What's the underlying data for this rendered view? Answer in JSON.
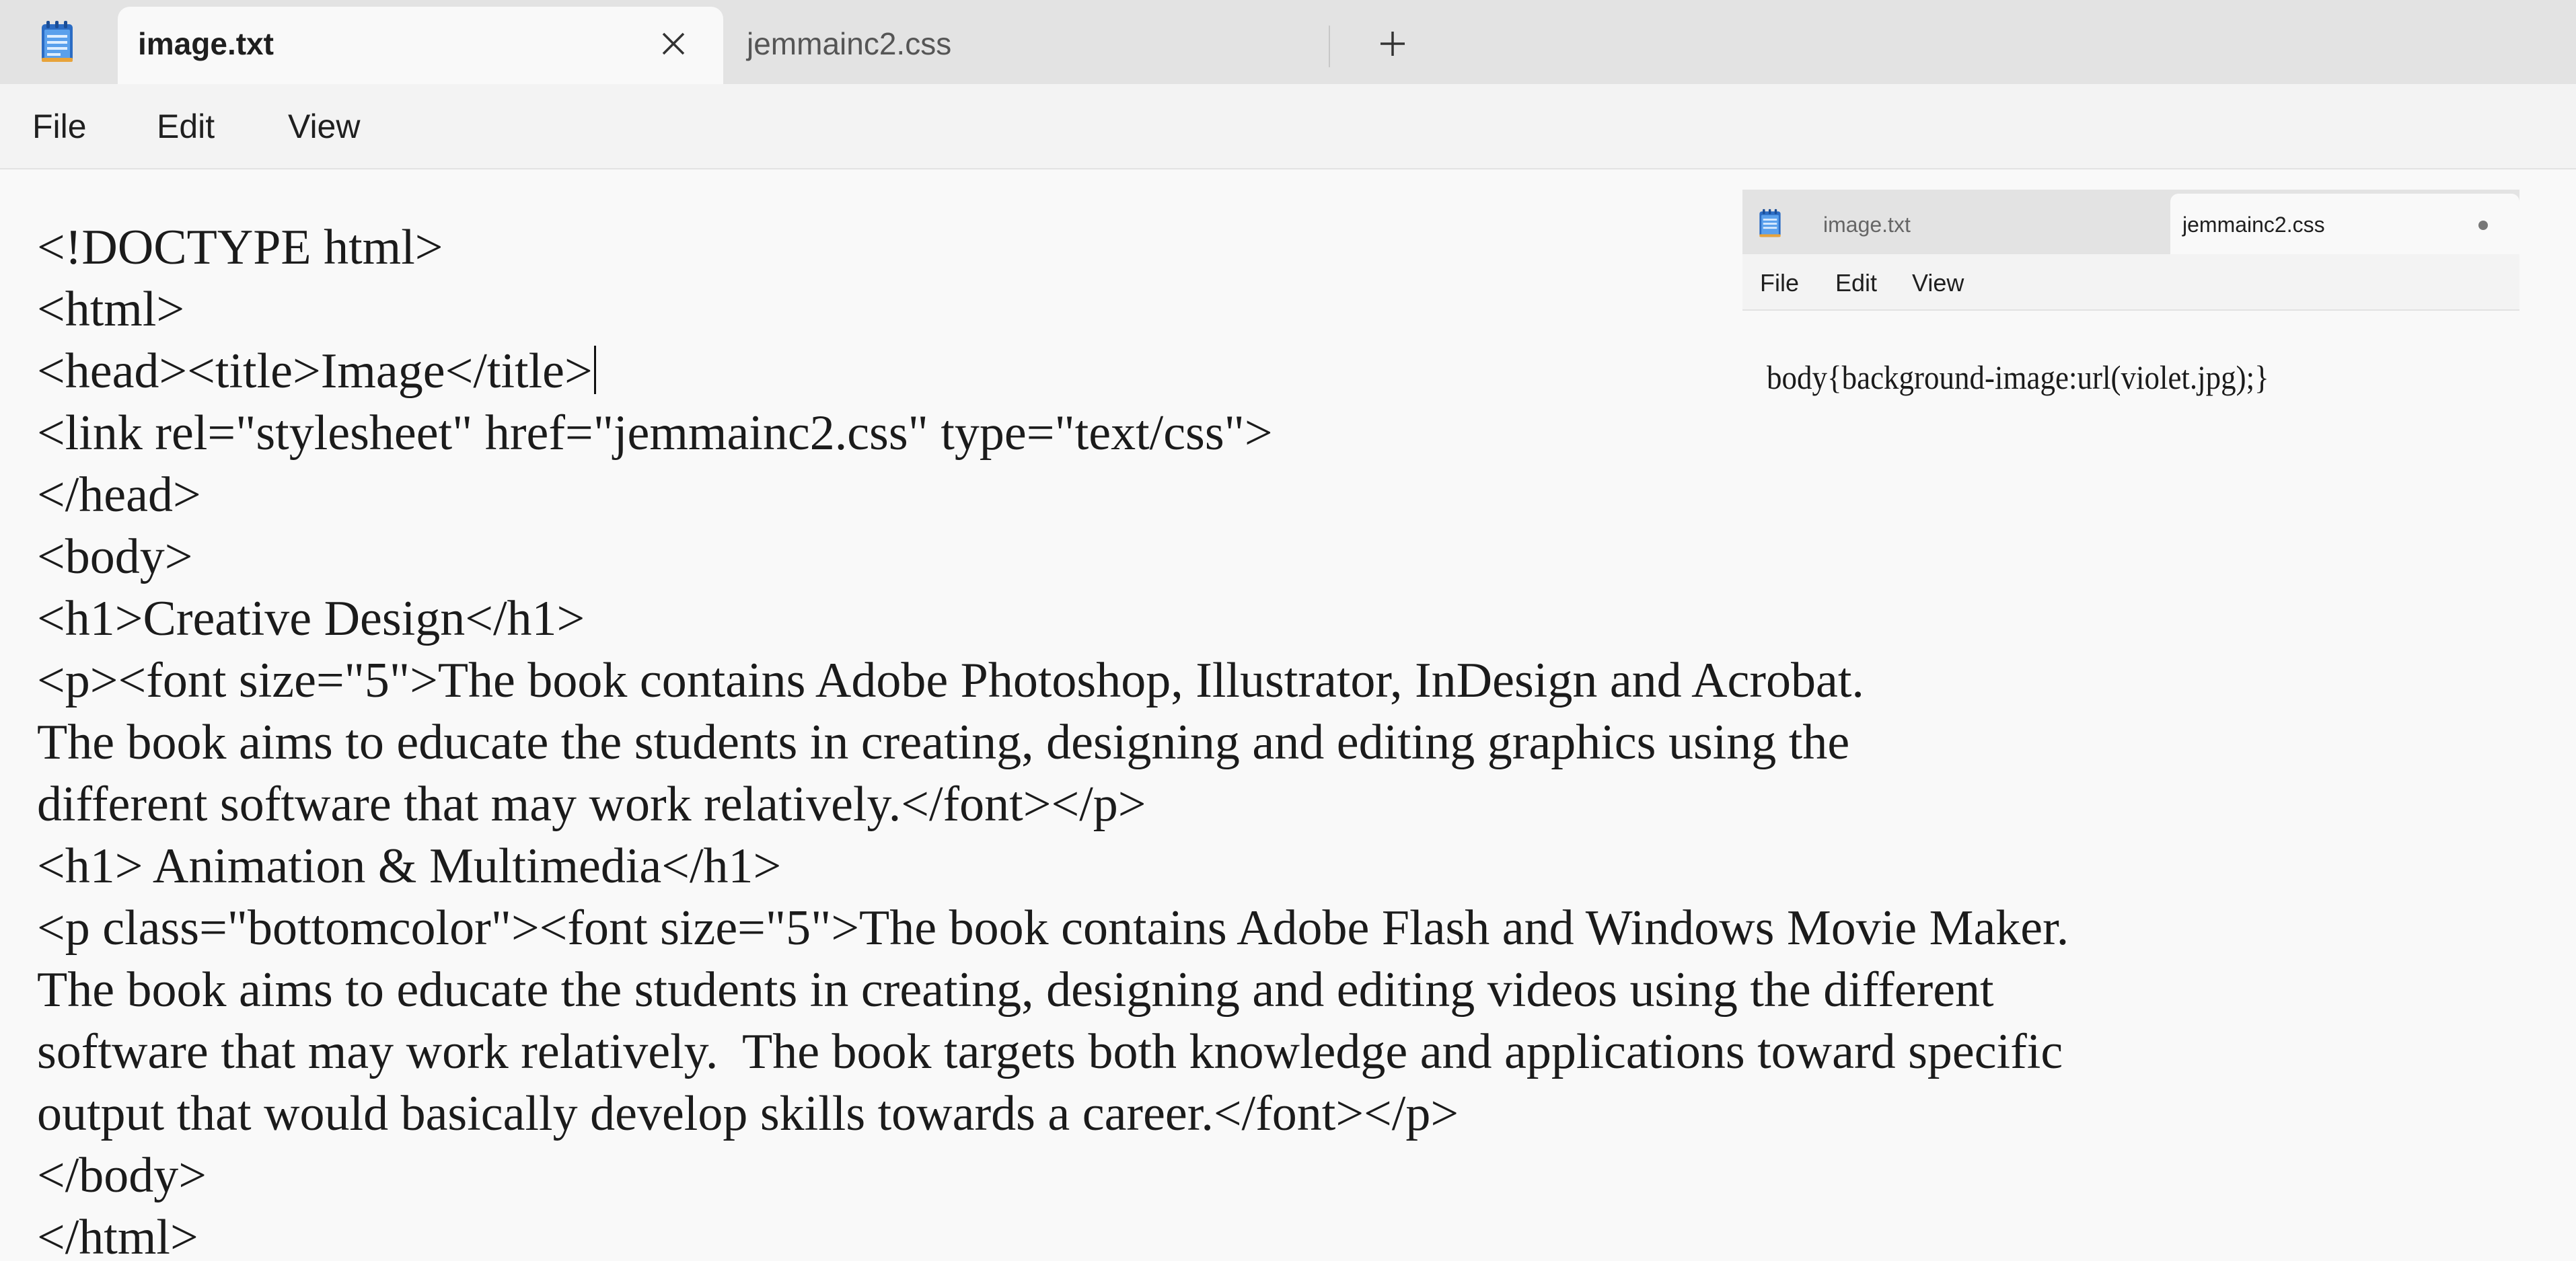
{
  "window": {
    "tabs": [
      {
        "label": "image.txt",
        "active": true
      },
      {
        "label": "jemmainc2.css",
        "active": false
      }
    ],
    "new_tab_icon": "plus-icon",
    "close_icon": "close-icon"
  },
  "menu": {
    "file": "File",
    "edit": "Edit",
    "view": "View"
  },
  "editor": {
    "lines": [
      "<!DOCTYPE html>",
      "<html>",
      "<head><title>Image</title>",
      "<link rel=\"stylesheet\" href=\"jemmainc2.css\" type=\"text/css\">",
      "</head>",
      "<body>",
      "<h1>Creative Design</h1>",
      "<p><font size=\"5\">The book contains Adobe Photoshop, Illustrator, InDesign and Acrobat.",
      "The book aims to educate the students in creating, designing and editing graphics using the",
      "different software that may work relatively.</font></p>",
      "<h1> Animation & Multimedia</h1>",
      "<p class=\"bottomcolor\"><font size=\"5\">The book contains Adobe Flash and Windows Movie Maker.",
      "The book aims to educate the students in creating, designing and editing videos using the different",
      "software that may work relatively.  The book targets both knowledge and applications toward specific",
      "output that would basically develop skills towards a career.</font></p>",
      "</body>",
      "</html>"
    ]
  },
  "inset": {
    "tabs": [
      "image.txt",
      "jemmainc2.css"
    ],
    "menu": [
      "File",
      "Edit",
      "View"
    ],
    "code": "body{background-image:url(violet.jpg);}"
  }
}
